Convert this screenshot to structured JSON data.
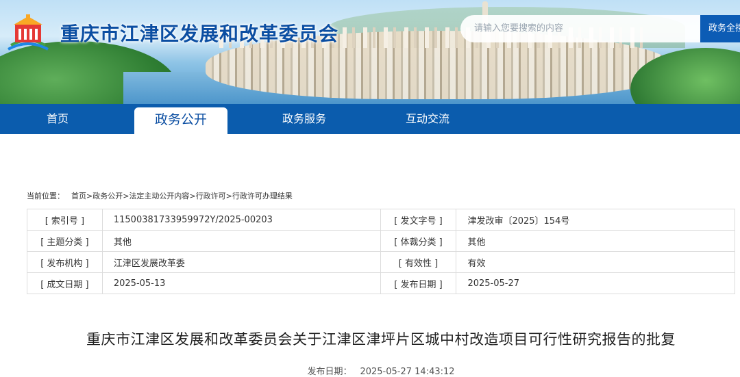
{
  "header": {
    "site_title": "重庆市江津区发展和改革委员会",
    "search_placeholder": "请输入您要搜索的内容",
    "search_button": "政务全搜"
  },
  "nav": {
    "items": [
      {
        "label": "首页"
      },
      {
        "label": "政务公开",
        "active": true
      },
      {
        "label": "政务服务"
      },
      {
        "label": "互动交流"
      }
    ]
  },
  "breadcrumb": {
    "label": "当前位置：",
    "items": [
      "首页",
      "政务公开",
      "法定主动公开内容",
      "行政许可",
      "行政许可办理结果"
    ],
    "separator": ">"
  },
  "info": {
    "index_key": "[ 索引号 ]",
    "index_val": "11500381733959972Y/2025-00203",
    "docno_key": "[ 发文字号 ]",
    "docno_val": "津发改审〔2025〕154号",
    "topic_key": "[ 主题分类 ]",
    "topic_val": "其他",
    "genre_key": "[ 体裁分类 ]",
    "genre_val": "其他",
    "org_key": "[ 发布机构 ]",
    "org_val": "江津区发展改革委",
    "valid_key": "[ 有效性 ]",
    "valid_val": "有效",
    "written_key": "[ 成文日期 ]",
    "written_val": "2025-05-13",
    "published_key": "[ 发布日期 ]",
    "published_val": "2025-05-27"
  },
  "article": {
    "title": "重庆市江津区发展和改革委员会关于江津区津坪片区城中村改造项目可行性研究报告的批复",
    "date_label": "发布日期：",
    "date_value": "2025-05-27 14:43:12"
  },
  "colors": {
    "brand_blue": "#0b5cad",
    "title_blue": "#0b4ea2"
  }
}
